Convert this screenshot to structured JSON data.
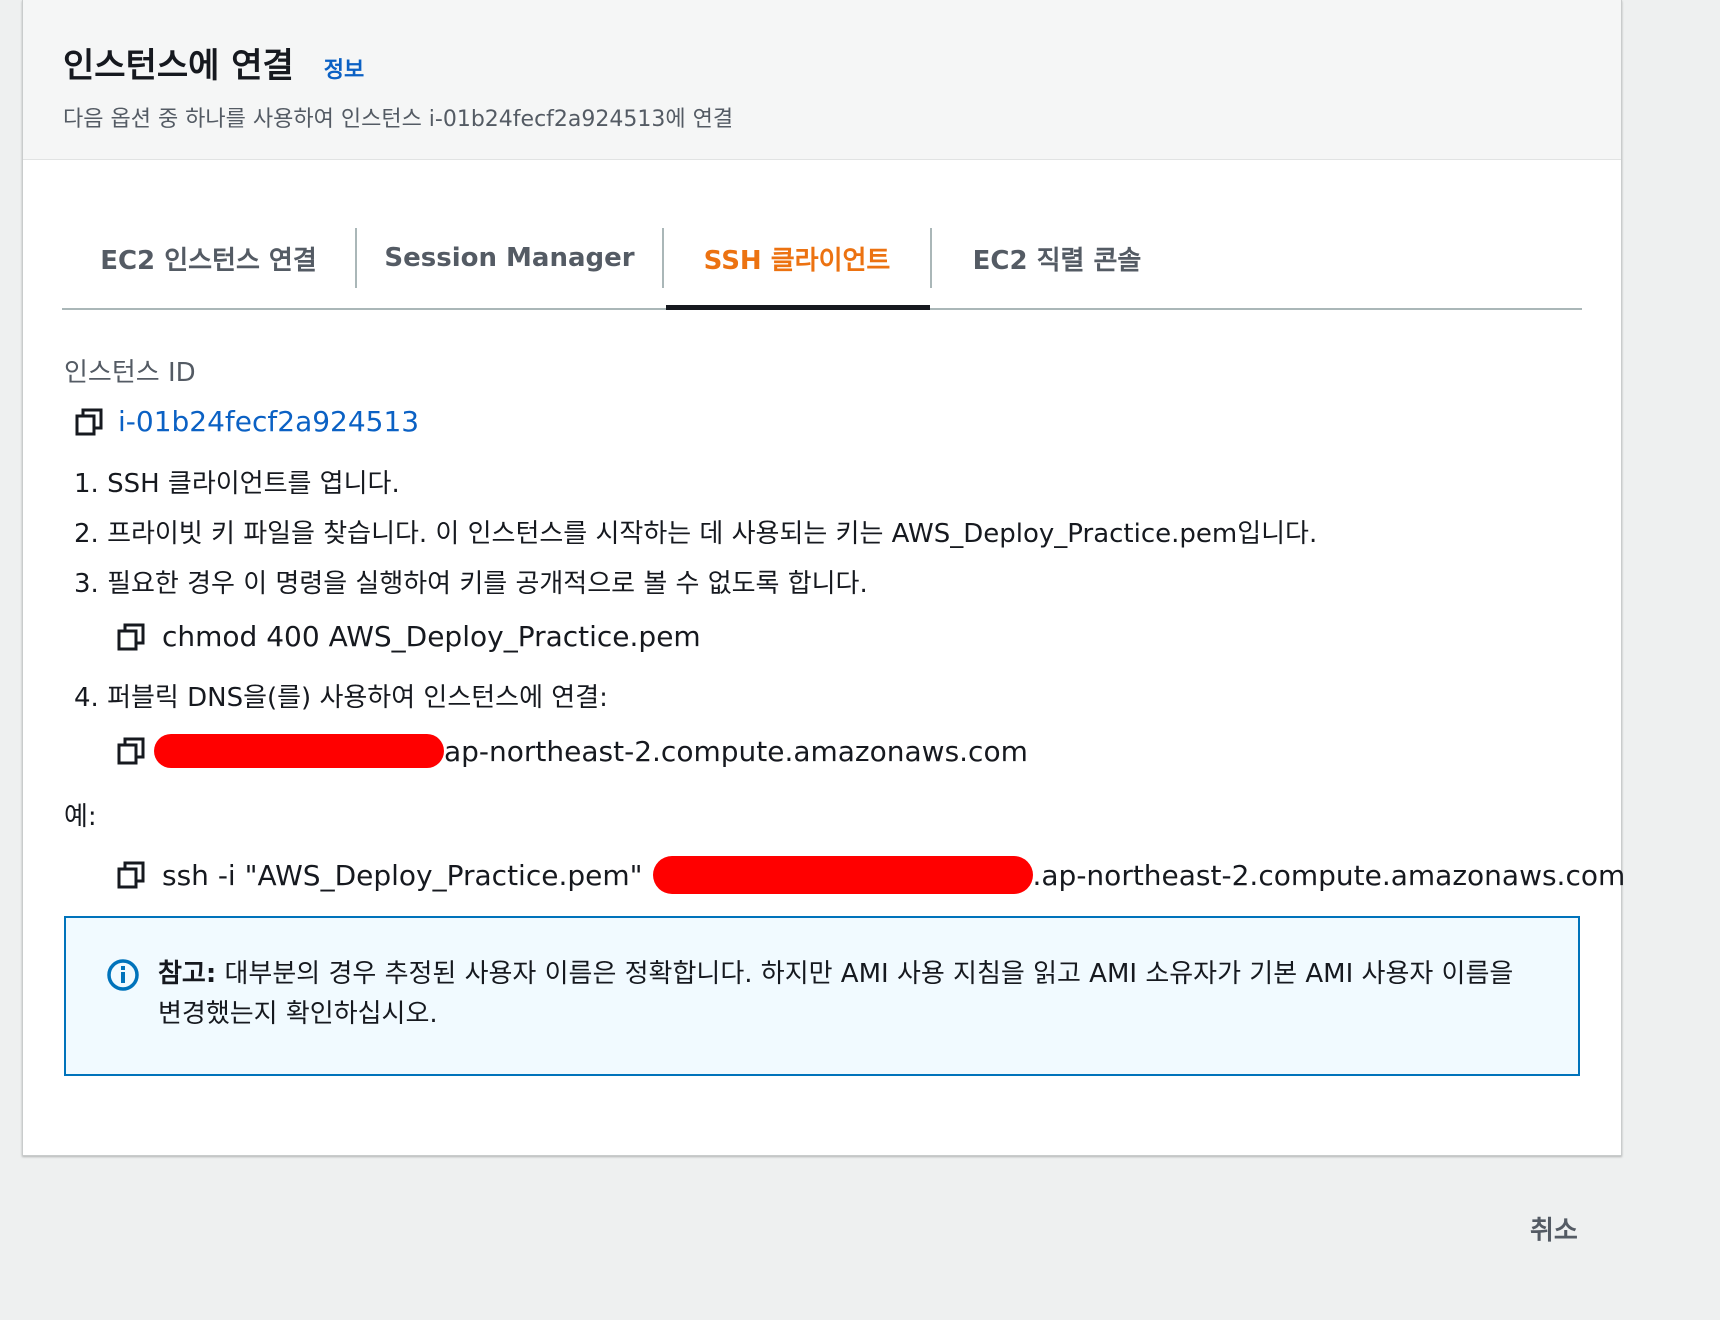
{
  "header": {
    "title": "인스턴스에 연결",
    "info_link": "정보",
    "subtitle": "다음 옵션 중 하나를 사용하여 인스턴스 i-01b24fecf2a924513에 연결"
  },
  "tabs": [
    {
      "label": "EC2 인스턴스 연결",
      "active": false
    },
    {
      "label": "Session Manager",
      "active": false
    },
    {
      "label": "SSH 클라이언트",
      "active": true
    },
    {
      "label": "EC2 직렬 콘솔",
      "active": false
    }
  ],
  "instance": {
    "label": "인스턴스 ID",
    "id": "i-01b24fecf2a924513"
  },
  "steps": [
    "1. SSH 클라이언트를 엽니다.",
    "2. 프라이빗 키 파일을 찾습니다. 이 인스턴스를 시작하는 데 사용되는 키는 AWS_Deploy_Practice.pem입니다.",
    "3. 필요한 경우 이 명령을 실행하여 키를 공개적으로 볼 수 없도록 합니다.",
    "4. 퍼블릭 DNS을(를) 사용하여 인스턴스에 연결:"
  ],
  "chmod_command": "chmod 400 AWS_Deploy_Practice.pem",
  "dns_suffix": "ap-northeast-2.compute.amazonaws.com",
  "example_label": "예:",
  "example": {
    "prefix": "ssh -i \"AWS_Deploy_Practice.pem\"",
    "suffix": ".ap-northeast-2.compute.amazonaws.com"
  },
  "alert": {
    "title": "참고:",
    "text": "대부분의 경우 추정된 사용자 이름은 정확합니다. 하지만 AMI 사용 지침을 읽고 AMI 소유자가 기본 AMI 사용자 이름을 변경했는지 확인하십시오."
  },
  "cancel_label": "취소",
  "colors": {
    "accent_tab": "#ec7211",
    "link": "#0b61c4",
    "alert_border": "#0073bb",
    "alert_bg": "#f1faff",
    "redaction": "#ff0000"
  }
}
